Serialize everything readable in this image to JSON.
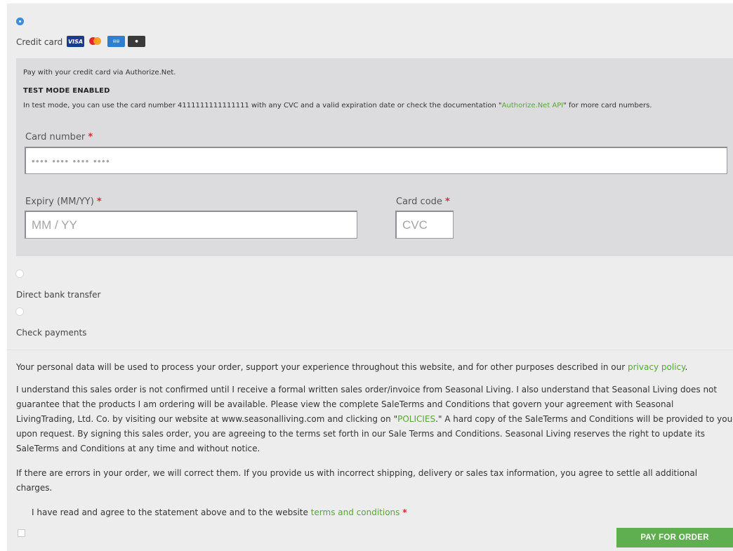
{
  "payment": {
    "credit_card_label": "Credit card",
    "card_brands": [
      "VISA",
      "MasterCard",
      "AMERICAN EXPRESS",
      "DISCOVER"
    ],
    "intro": "Pay with your credit card via Authorize.Net.",
    "test_mode_title": "TEST MODE ENABLED",
    "test_mode_prefix": "In test mode, you can use the card number 4111111111111111 with any CVC and a valid expiration date or check the documentation \"",
    "test_mode_link": "Authorize.Net API",
    "test_mode_suffix": "\" for more card numbers.",
    "card_number_label": "Card number",
    "card_number_placeholder": "•••• •••• •••• ••••",
    "expiry_label": "Expiry (MM/YY)",
    "expiry_placeholder": "MM / YY",
    "card_code_label": "Card code",
    "card_code_placeholder": "CVC",
    "required_mark": "*",
    "bank_transfer_label": "Direct bank transfer",
    "check_payments_label": "Check payments"
  },
  "terms": {
    "privacy_prefix": "Your personal data will be used to process your order, support your experience throughout this website, and for other purposes described in our ",
    "privacy_link": "privacy policy",
    "privacy_suffix": ".",
    "sales_prefix": "I understand this sales order is not confirmed until I receive a formal written sales order/invoice from Seasonal Living. I also understand that Seasonal Living does not guarantee that the products I am ordering will be available. Please view the complete SaleTerms and Conditions that govern your agreement with Seasonal LivingTrading, Ltd. Co. by visiting our website at www.seasonalliving.com and clicking on \"",
    "sales_link": "POLICIES",
    "sales_suffix": ".\" A hard copy of the SaleTerms and Conditions will be provided to you upon request. By signing this sales order, you are agreeing to the terms set forth in our Sale Terms and Conditions. Seasonal Living reserves the right to update its SaleTerms and Conditions at any time and without notice.",
    "errors_text": "If there are errors in your order, we will correct them. If you provide us with incorrect shipping, delivery or sales tax information, you agree to settle all additional charges.",
    "agree_prefix": "I have read and agree to the statement above and to the website ",
    "agree_link": "terms and conditions",
    "required_mark": "*"
  },
  "actions": {
    "pay_label": "PAY FOR ORDER"
  },
  "colors": {
    "accent_green": "#5fae4f",
    "link_green": "#5aa33c",
    "required_red": "#e4262b",
    "radio_blue": "#3b8fde"
  }
}
